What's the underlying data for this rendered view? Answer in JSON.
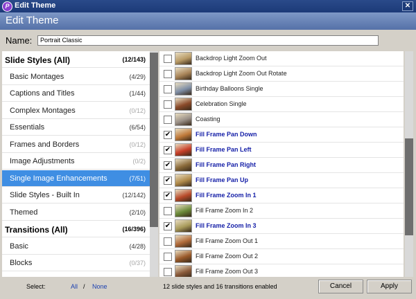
{
  "window": {
    "title": "Edit Theme",
    "header": "Edit Theme",
    "icon": "app-logo-icon"
  },
  "name_field": {
    "label": "Name:",
    "value": "Portrait Classic"
  },
  "categories": [
    {
      "label": "Slide Styles (All)",
      "count": "(12/143)",
      "heading": true
    },
    {
      "label": "Basic Montages",
      "count": "(4/29)"
    },
    {
      "label": "Captions and Titles",
      "count": "(1/44)"
    },
    {
      "label": "Complex Montages",
      "count": "(0/12)",
      "dim": true
    },
    {
      "label": "Essentials",
      "count": "(6/54)"
    },
    {
      "label": "Frames and Borders",
      "count": "(0/12)",
      "dim": true
    },
    {
      "label": "Image Adjustments",
      "count": "(0/2)",
      "dim": true
    },
    {
      "label": "Single Image Enhancements",
      "count": "(7/51)",
      "selected": true
    },
    {
      "label": "Slide Styles - Built In",
      "count": "(12/142)"
    },
    {
      "label": "Themed",
      "count": "(2/10)"
    },
    {
      "label": "Transitions (All)",
      "count": "(16/396)",
      "heading": true
    },
    {
      "label": "Basic",
      "count": "(4/28)"
    },
    {
      "label": "Blocks",
      "count": "(0/37)",
      "dim": true
    }
  ],
  "styles": [
    {
      "label": "Backdrop Light Zoom Out",
      "checked": false,
      "thumb": "#b89a66"
    },
    {
      "label": "Backdrop Light Zoom Out Rotate",
      "checked": false,
      "thumb": "#a88458"
    },
    {
      "label": "Birthday Balloons Single",
      "checked": false,
      "thumb": "#7e8ea6"
    },
    {
      "label": "Celebration Single",
      "checked": false,
      "thumb": "#8a4a2a"
    },
    {
      "label": "Coasting",
      "checked": false,
      "thumb": "#9a9088"
    },
    {
      "label": "Fill Frame Pan Down",
      "checked": true,
      "thumb": "#c07a3a"
    },
    {
      "label": "Fill Frame Pan Left",
      "checked": true,
      "thumb": "#c8402a"
    },
    {
      "label": "Fill Frame Pan Right",
      "checked": true,
      "thumb": "#8a6a3a"
    },
    {
      "label": "Fill Frame Pan Up",
      "checked": true,
      "thumb": "#b08a4a"
    },
    {
      "label": "Fill Frame Zoom In 1",
      "checked": true,
      "thumb": "#b84a2a"
    },
    {
      "label": "Fill Frame Zoom In 2",
      "checked": false,
      "thumb": "#6a8a3a"
    },
    {
      "label": "Fill Frame Zoom In 3",
      "checked": true,
      "thumb": "#a89a5a"
    },
    {
      "label": "Fill Frame Zoom Out 1",
      "checked": false,
      "thumb": "#b06a3a"
    },
    {
      "label": "Fill Frame Zoom Out 2",
      "checked": false,
      "thumb": "#9a5a2a"
    },
    {
      "label": "Fill Frame Zoom Out 3",
      "checked": false,
      "thumb": "#8a5a3a"
    }
  ],
  "footer": {
    "select_label": "Select:",
    "all_link": "All",
    "separator": "/",
    "none_link": "None",
    "status": "12 slide styles and 16 transitions enabled",
    "cancel": "Cancel",
    "apply": "Apply"
  },
  "colors": {
    "selected": "#3f8ee3",
    "enabled_text": "#1620a8",
    "header": "#6883b8"
  }
}
